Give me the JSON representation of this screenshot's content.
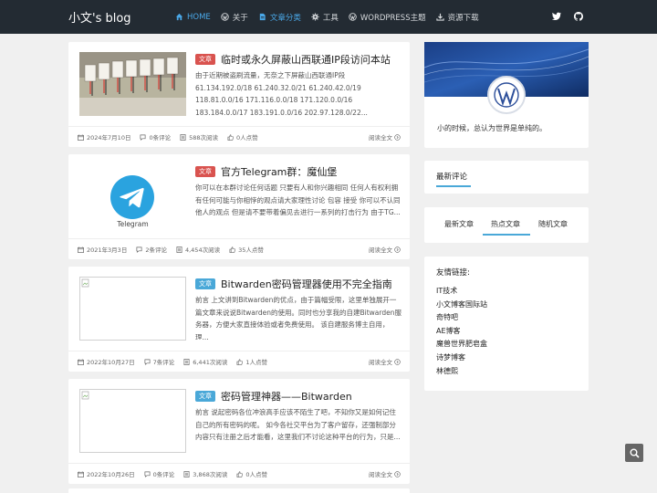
{
  "brand": "小文's blog",
  "nav": {
    "items": [
      {
        "label": "HOME",
        "icon": "home-icon",
        "active": true
      },
      {
        "label": "关于",
        "icon": "wordpress-icon"
      },
      {
        "label": "文章分类",
        "icon": "file-icon",
        "active": true
      },
      {
        "label": "工具",
        "icon": "gear-icon"
      },
      {
        "label": "WORDPRESS主题",
        "icon": "wordpress-icon"
      },
      {
        "label": "资源下载",
        "icon": "download-icon"
      }
    ],
    "social": [
      "twitter-icon",
      "github-icon"
    ]
  },
  "posts": [
    {
      "badge": "文章",
      "badge_color": "#d9534f",
      "title": "临时或永久屏蔽山西联通IP段访问本站",
      "excerpt": "由于近期被盗刷流量，无奈之下屏蔽山西联通IP段 61.134.192.0/18 61.240.32.0/21 61.240.42.0/19 118.81.0.0/16 171.116.0.0/18 171.120.0.0/16 183.184.0.0/17 183.191.0.0/16 202.97.128.0/22...",
      "date": "2024年7月10日",
      "comments": "0条评论",
      "views": "588次阅读",
      "likes": "0人点赞",
      "readmore": "阅读全文"
    },
    {
      "badge": "文章",
      "badge_color": "#d9534f",
      "title": "官方Telegram群：魔仙堡",
      "thumb_label": "Telegram",
      "excerpt": "你可以在本群讨论任何话题 只要有人和你兴趣相同 任何人有权利拥有任何可能与你相悖的观点请大家理性讨论 包容 接受 你可以不认同他人的观点 但是请不要带着偏见去进行一系列的打击行为 由于TG...",
      "date": "2021年3月3日",
      "comments": "2条评论",
      "views": "4,454次阅读",
      "likes": "35人点赞",
      "readmore": "阅读全文"
    },
    {
      "badge": "文章",
      "badge_color": "#4aa8d8",
      "title": "Bitwarden密码管理器使用不完全指南",
      "excerpt": "前言 上文讲到Bitwarden的优点，由于篇幅受限，这里单独展开一篇文章来说说Bitwarden的使用。同时也分享我的自建Bitwarden服务器，方便大家直接体验或者免费使用。 该自建服务博主自用，理...",
      "date": "2022年10月27日",
      "comments": "7条评论",
      "views": "6,441次阅读",
      "likes": "1人点赞",
      "readmore": "阅读全文"
    },
    {
      "badge": "文章",
      "badge_color": "#4aa8d8",
      "title": "密码管理神器——Bitwarden",
      "excerpt": "前言 说起密码各位冲浪高手应该不陌生了吧，不知你又是如何记住自己的所有密码的呢。 如今各社交平台为了客户留存，还强制部分内容只有注册之后才能看，这里我们不讨论这种平台的行为，只是...",
      "date": "2022年10月26日",
      "comments": "0条评论",
      "views": "3,868次阅读",
      "likes": "0人点赞",
      "readmore": "阅读全文"
    }
  ],
  "sidebar": {
    "motto": "小的时候，总认为世界是单纯的。",
    "recent_comments_title": "最新评论",
    "tabs": [
      "最新文章",
      "热点文章",
      "随机文章"
    ],
    "active_tab": "热点文章",
    "links_title": "友情链接:",
    "links": [
      "IT技术",
      "小文博客国际站",
      "奇特吧",
      "AE博客",
      "魔兽世界肥皂盒",
      "诗梦博客",
      "林德熙"
    ]
  }
}
